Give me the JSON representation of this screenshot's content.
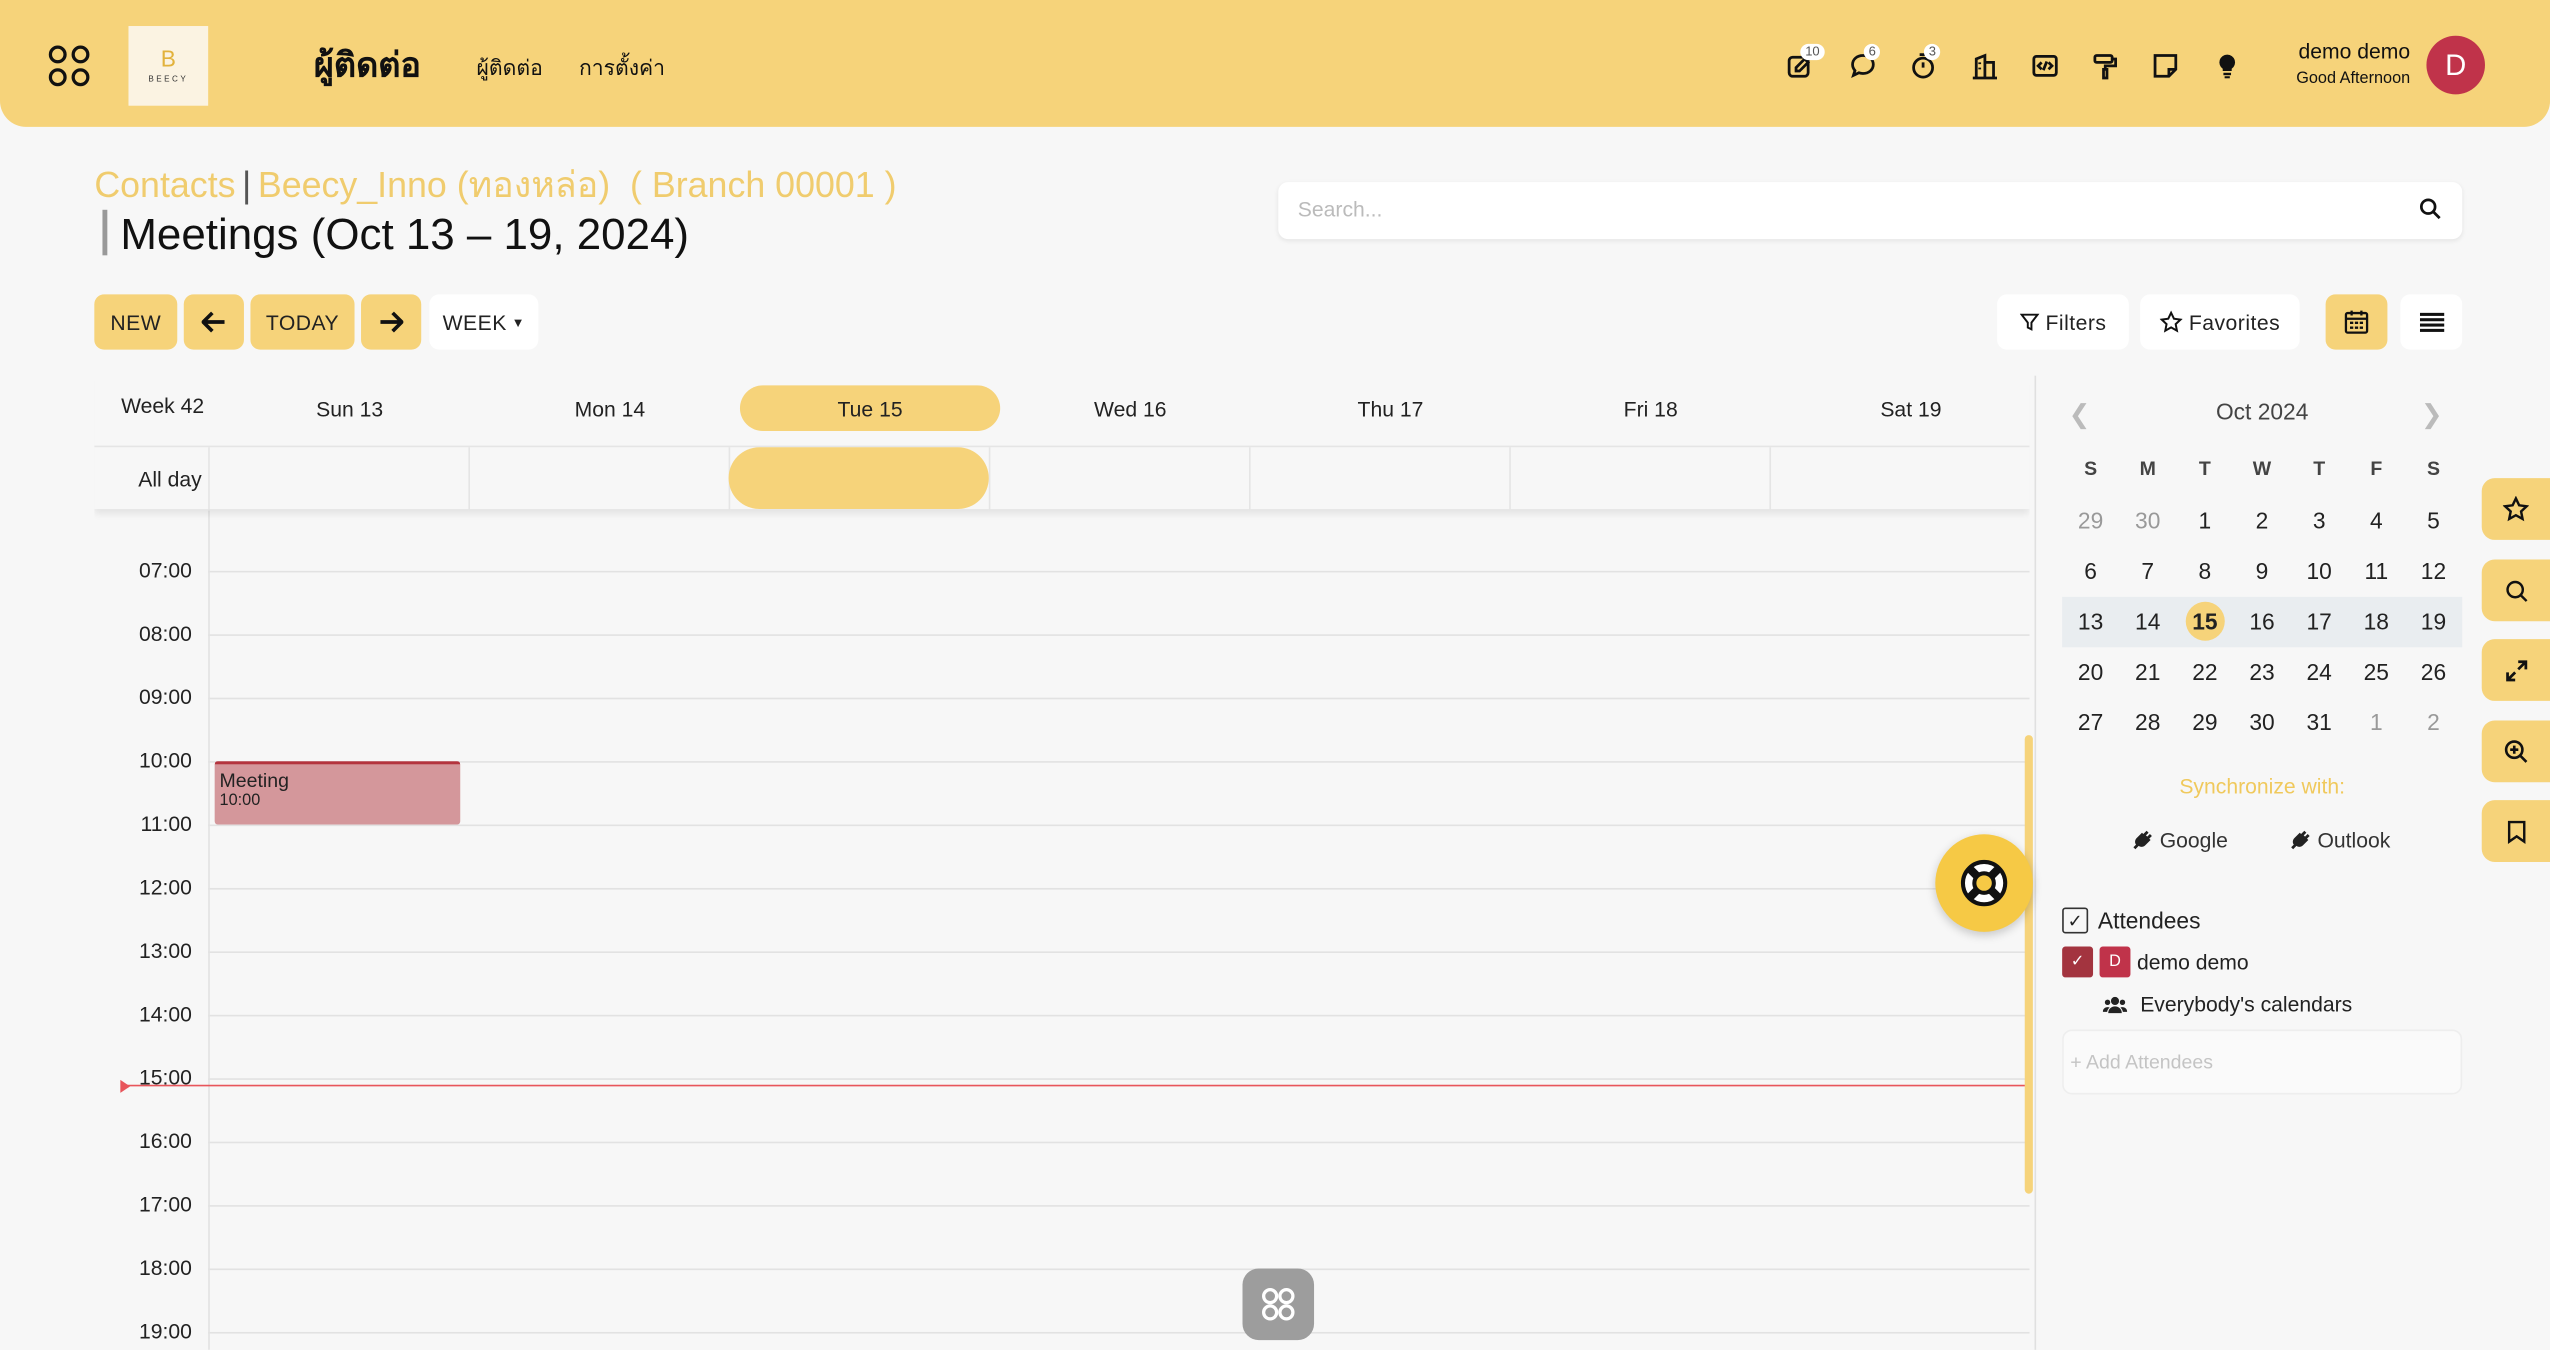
{
  "header": {
    "logo_letter": "B",
    "logo_text": "BEECY",
    "app_title": "ผู้ติดต่อ",
    "menu": [
      "ผู้ติดต่อ",
      "การตั้งค่า"
    ],
    "icons": [
      {
        "name": "activity-icon",
        "badge": "10"
      },
      {
        "name": "chat-icon",
        "badge": "6"
      },
      {
        "name": "timer-icon",
        "badge": "3"
      },
      {
        "name": "company-icon",
        "badge": ""
      },
      {
        "name": "code-icon",
        "badge": ""
      },
      {
        "name": "paint-roller-icon",
        "badge": ""
      },
      {
        "name": "note-icon",
        "badge": ""
      },
      {
        "name": "lightbulb-icon",
        "badge": ""
      }
    ],
    "user_name": "demo demo",
    "greeting": "Good Afternoon",
    "avatar_letter": "D"
  },
  "breadcrumb": {
    "items": [
      "Contacts",
      "Beecy_Inno (ทองหล่อ)  ( Branch 00001 )"
    ],
    "current": "Meetings (Oct 13 – 19, 2024)"
  },
  "search": {
    "placeholder": "Search..."
  },
  "toolbar": {
    "new": "NEW",
    "today": "TODAY",
    "scale": "WEEK",
    "filters": "Filters",
    "favorites": "Favorites"
  },
  "calendar": {
    "week_label": "Week 42",
    "days": [
      "Sun 13",
      "Mon 14",
      "Tue 15",
      "Wed 16",
      "Thu 17",
      "Fri 18",
      "Sat 19"
    ],
    "today_index": 2,
    "all_day": "All day",
    "hours": [
      "07:00",
      "08:00",
      "09:00",
      "10:00",
      "11:00",
      "12:00",
      "13:00",
      "14:00",
      "15:00",
      "16:00",
      "17:00",
      "18:00",
      "19:00"
    ],
    "events": [
      {
        "title": "Meeting",
        "time": "10:00",
        "day": 0,
        "start": 10,
        "end": 11
      }
    ],
    "now_time": 15.1
  },
  "mini_calendar": {
    "title": "Oct 2024",
    "weekday_headers": [
      "S",
      "M",
      "T",
      "W",
      "T",
      "F",
      "S"
    ],
    "weeks": [
      [
        {
          "d": "29",
          "o": true
        },
        {
          "d": "30",
          "o": true
        },
        {
          "d": "1"
        },
        {
          "d": "2"
        },
        {
          "d": "3"
        },
        {
          "d": "4"
        },
        {
          "d": "5"
        }
      ],
      [
        {
          "d": "6"
        },
        {
          "d": "7"
        },
        {
          "d": "8"
        },
        {
          "d": "9"
        },
        {
          "d": "10"
        },
        {
          "d": "11"
        },
        {
          "d": "12"
        }
      ],
      [
        {
          "d": "13"
        },
        {
          "d": "14"
        },
        {
          "d": "15",
          "today": true
        },
        {
          "d": "16"
        },
        {
          "d": "17"
        },
        {
          "d": "18"
        },
        {
          "d": "19"
        }
      ],
      [
        {
          "d": "20"
        },
        {
          "d": "21"
        },
        {
          "d": "22"
        },
        {
          "d": "23"
        },
        {
          "d": "24"
        },
        {
          "d": "25"
        },
        {
          "d": "26"
        }
      ],
      [
        {
          "d": "27"
        },
        {
          "d": "28"
        },
        {
          "d": "29"
        },
        {
          "d": "30"
        },
        {
          "d": "31"
        },
        {
          "d": "1",
          "o": true
        },
        {
          "d": "2",
          "o": true
        }
      ]
    ],
    "current_week_index": 2
  },
  "sync": {
    "label": "Synchronize with:",
    "google": "Google",
    "outlook": "Outlook"
  },
  "attendees": {
    "title": "Attendees",
    "list": [
      {
        "name": "demo demo",
        "avatar": "D"
      }
    ],
    "everybody": "Everybody's calendars",
    "add_placeholder": "+ Add Attendees"
  },
  "colors": {
    "accent": "#f6d37a",
    "event": "#d4979b",
    "now_line": "#e8555b",
    "avatar": "#c0334a"
  }
}
